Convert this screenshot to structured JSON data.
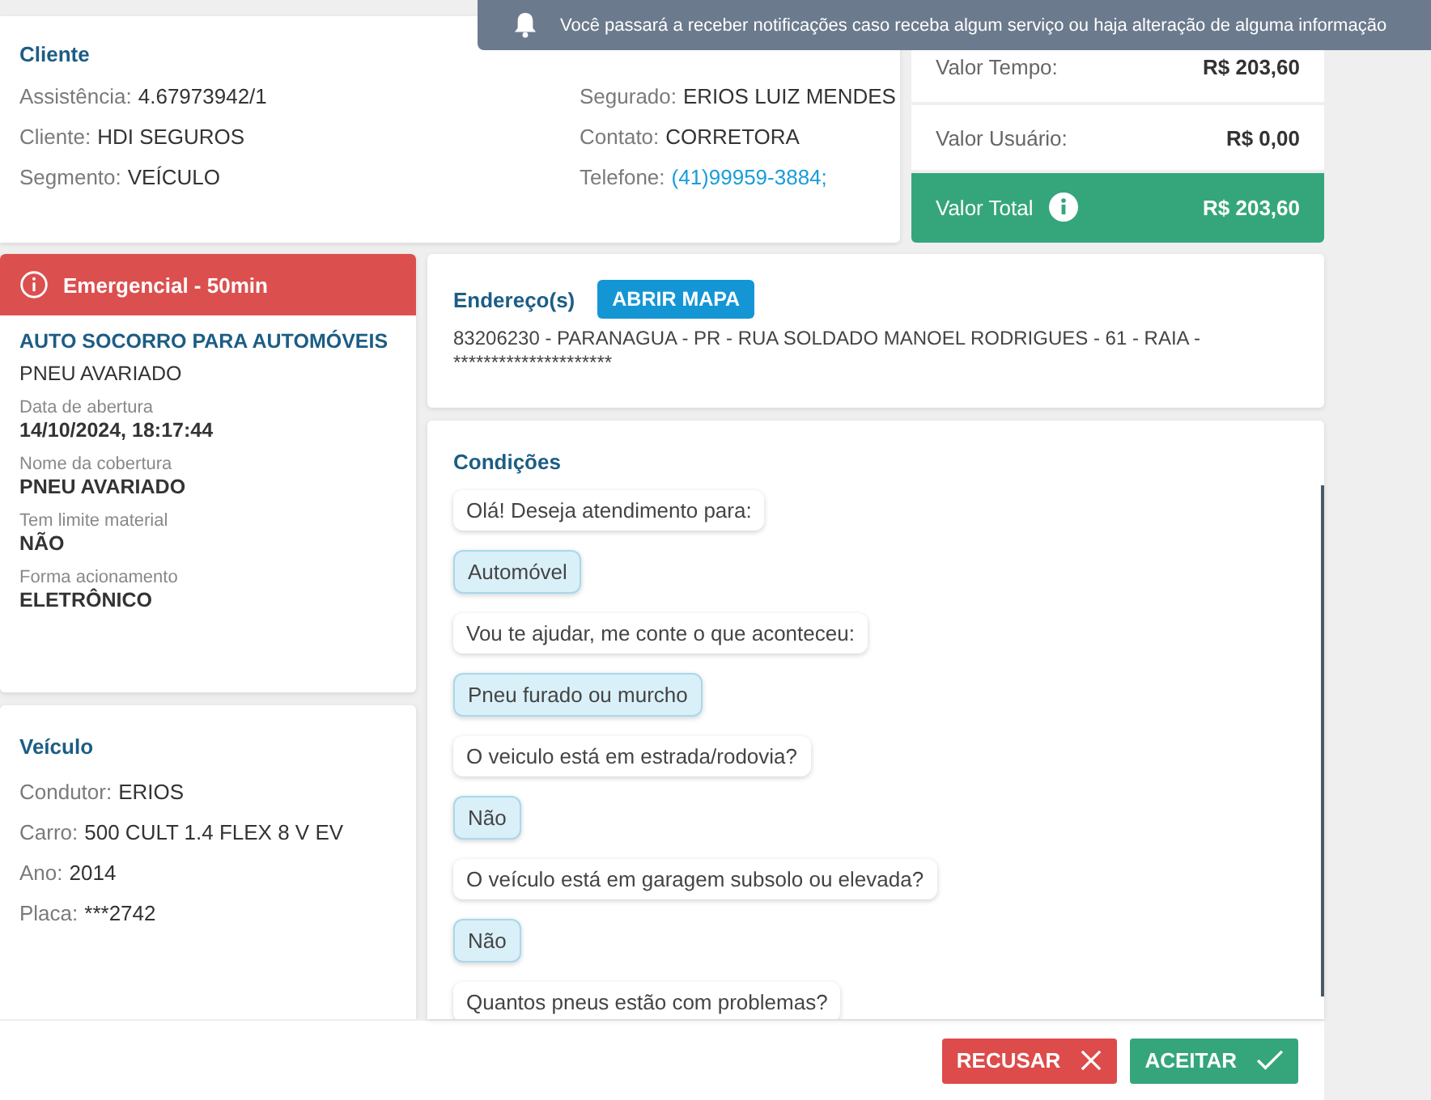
{
  "notification": {
    "text": "Você passará a receber notificações caso receba algum serviço ou haja alteração de alguma informação"
  },
  "client": {
    "title": "Cliente",
    "left": [
      {
        "label": "Assistência:",
        "value": "4.67973942/1",
        "link": false
      },
      {
        "label": "Cliente:",
        "value": "HDI SEGUROS",
        "link": false
      },
      {
        "label": "Segmento:",
        "value": "VEÍCULO",
        "link": false
      }
    ],
    "right": [
      {
        "label": "Segurado:",
        "value": "ERIOS LUIZ MENDES",
        "link": false
      },
      {
        "label": "Contato:",
        "value": "CORRETORA",
        "link": false
      },
      {
        "label": "Telefone:",
        "value": "(41)99959-3884;",
        "link": true
      }
    ]
  },
  "values": [
    {
      "label": "Valor Tempo:",
      "value": "R$ 203,60",
      "kind": "plain"
    },
    {
      "label": "Valor Usuário:",
      "value": "R$ 0,00",
      "kind": "plain"
    },
    {
      "label": "Valor Total",
      "value": "R$ 203,60",
      "kind": "total"
    }
  ],
  "service": {
    "badge": "Emergencial - 50min",
    "title": "AUTO SOCORRO PARA AUTOMÓVEIS",
    "subtitle": "PNEU AVARIADO",
    "fields": [
      {
        "label": "Data de abertura",
        "value": "14/10/2024, 18:17:44"
      },
      {
        "label": "Nome da cobertura",
        "value": "PNEU AVARIADO"
      },
      {
        "label": "Tem limite material",
        "value": "NÃO"
      },
      {
        "label": "Forma acionamento",
        "value": "ELETRÔNICO"
      }
    ]
  },
  "vehicle": {
    "title": "Veículo",
    "rows": [
      {
        "label": "Condutor:",
        "value": "ERIOS"
      },
      {
        "label": "Carro:",
        "value": "500 CULT 1.4 FLEX 8 V EV"
      },
      {
        "label": "Ano:",
        "value": "2014"
      },
      {
        "label": "Placa:",
        "value": "***2742"
      }
    ]
  },
  "address": {
    "title": "Endereço(s)",
    "button": "ABRIR MAPA",
    "text": "83206230 - PARANAGUA - PR - RUA SOLDADO MANOEL RODRIGUES - 61 - RAIA - *********************"
  },
  "conditions": {
    "title": "Condições",
    "messages": [
      {
        "text": "Olá! Deseja atendimento para:",
        "kind": "question"
      },
      {
        "text": "Automóvel",
        "kind": "answer"
      },
      {
        "text": "Vou te ajudar, me conte o que aconteceu:",
        "kind": "question"
      },
      {
        "text": "Pneu furado ou murcho",
        "kind": "answer"
      },
      {
        "text": "O veiculo está em estrada/rodovia?",
        "kind": "question"
      },
      {
        "text": "Não",
        "kind": "answer"
      },
      {
        "text": "O veículo está em garagem subsolo ou elevada?",
        "kind": "question"
      },
      {
        "text": "Não",
        "kind": "answer"
      },
      {
        "text": "Quantos pneus estão com problemas?",
        "kind": "question"
      }
    ]
  },
  "actions": [
    {
      "label": "RECUSAR",
      "kind": "reject"
    },
    {
      "label": "ACEITAR",
      "kind": "accept"
    }
  ]
}
